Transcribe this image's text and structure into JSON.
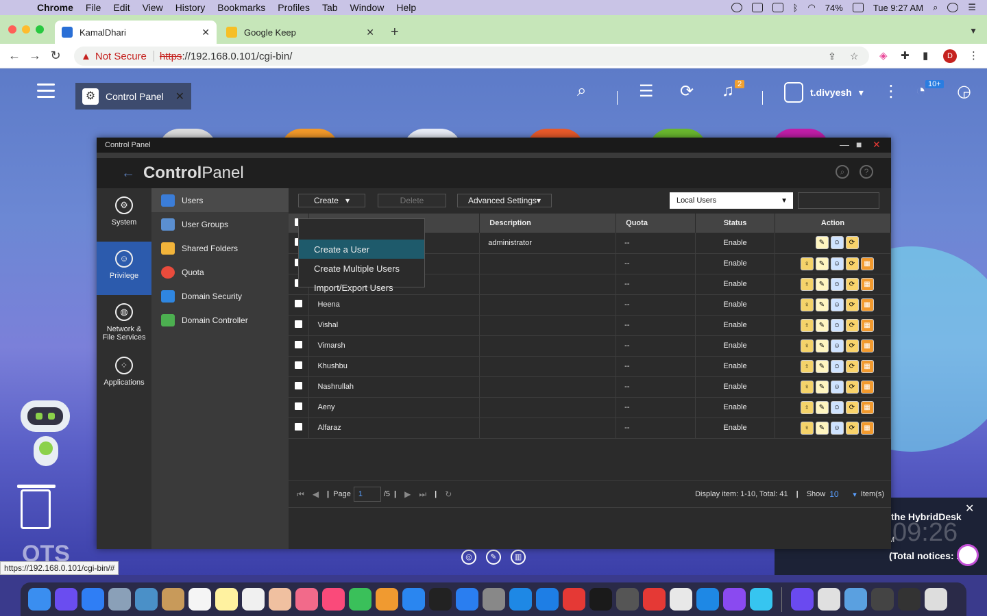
{
  "menubar": {
    "app": "Chrome",
    "items": [
      "File",
      "Edit",
      "View",
      "History",
      "Bookmarks",
      "Profiles",
      "Tab",
      "Window",
      "Help"
    ],
    "battery": "74%",
    "datetime": "Tue 9:27 AM"
  },
  "tabs": [
    {
      "title": "KamalDhari",
      "active": true
    },
    {
      "title": "Google Keep",
      "active": false
    }
  ],
  "toolbar": {
    "not_secure": "Not Secure",
    "url_scheme": "https",
    "url_rest": "://192.168.0.101/cgi-bin/",
    "profile_initial": "D"
  },
  "qts": {
    "open_app_tab": "Control Panel",
    "notifications_badge": "2",
    "username": "t.divyesh",
    "events_badge": "10+",
    "logo": "QTS",
    "status_url": "https://192.168.0.101/cgi-bin/#"
  },
  "window": {
    "title": "Control Panel",
    "header_title_bold": "Control",
    "header_title_light": "Panel"
  },
  "leftnav": [
    {
      "label": "System",
      "icon": "gear-icon",
      "active": false
    },
    {
      "label": "Privilege",
      "icon": "user-icon",
      "active": true
    },
    {
      "label": "Network &",
      "label2": "File Services",
      "icon": "globe-icon",
      "active": false
    },
    {
      "label": "Applications",
      "icon": "apps-icon",
      "active": false
    }
  ],
  "subnav": [
    {
      "label": "Users",
      "active": true,
      "color": "#3b7dd8"
    },
    {
      "label": "User Groups",
      "active": false,
      "color": "#5b8fd0"
    },
    {
      "label": "Shared Folders",
      "active": false,
      "color": "#f2b43a"
    },
    {
      "label": "Quota",
      "active": false,
      "color": "#e94b3c"
    },
    {
      "label": "Domain Security",
      "active": false,
      "color": "#2f86e0"
    },
    {
      "label": "Domain Controller",
      "active": false,
      "color": "#4caf50"
    }
  ],
  "buttons": {
    "create": "Create",
    "delete": "Delete",
    "advanced": "Advanced Settings",
    "user_type": "Local Users"
  },
  "dropdown": [
    "Create a User",
    "Create Multiple Users",
    "Import/Export Users"
  ],
  "table": {
    "headers": [
      "Description",
      "Quota",
      "Status",
      "Action"
    ],
    "rows": [
      {
        "name": "",
        "description": "administrator",
        "quota": "--",
        "status": "Enable",
        "actions": 3
      },
      {
        "name": "",
        "description": "",
        "quota": "--",
        "status": "Enable",
        "actions": 5
      },
      {
        "name": "",
        "description": "",
        "quota": "--",
        "status": "Enable",
        "actions": 5
      },
      {
        "name": "Heena",
        "description": "",
        "quota": "--",
        "status": "Enable",
        "actions": 5
      },
      {
        "name": "Vishal",
        "description": "",
        "quota": "--",
        "status": "Enable",
        "actions": 5
      },
      {
        "name": "Vimarsh",
        "description": "",
        "quota": "--",
        "status": "Enable",
        "actions": 5
      },
      {
        "name": "Khushbu",
        "description": "",
        "quota": "--",
        "status": "Enable",
        "actions": 5
      },
      {
        "name": "Nashrullah",
        "description": "",
        "quota": "--",
        "status": "Enable",
        "actions": 5
      },
      {
        "name": "Aeny",
        "description": "",
        "quota": "--",
        "status": "Enable",
        "actions": 5
      },
      {
        "name": "Alfaraz",
        "description": "",
        "quota": "--",
        "status": "Enable",
        "actions": 5
      }
    ]
  },
  "pager": {
    "page_label": "Page",
    "page_value": "1",
    "page_total": "/5",
    "display": "Display item: 1-10, Total: 41",
    "show_label": "Show",
    "show_value": "10",
    "items_label": "Item(s)"
  },
  "notice": {
    "title": "the HybridDesk",
    "clock": "09:26",
    "total": "(Total notices: 2)"
  }
}
